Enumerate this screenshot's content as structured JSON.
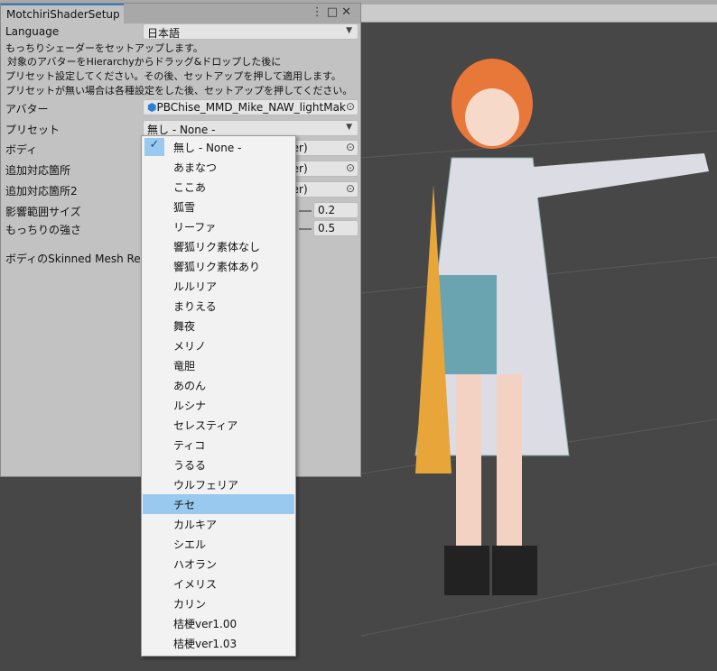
{
  "window": {
    "title": "MotchiriShaderSetup",
    "icons": [
      "more-icon",
      "maximize-icon",
      "close-icon"
    ]
  },
  "language": {
    "label": "Language",
    "value": "日本語"
  },
  "description": [
    "もっちりシェーダーをセットアップします。",
    "対象のアバターをHierarchyからドラッグ&ドロップした後に",
    "プリセット設定してください。その後、セットアップを押して適用します。",
    "プリセットが無い場合は各種設定をした後、セットアップを押してください。"
  ],
  "avatar": {
    "label": "アバター",
    "value": "PBChise_MMD_Mike_NAW_lightMake"
  },
  "preset": {
    "label": "プリセット",
    "value": "無し - None -"
  },
  "body": {
    "label": "ボディ",
    "value": "rer)"
  },
  "extra1": {
    "label": "追加対応箇所",
    "value": "rer)"
  },
  "extra2": {
    "label": "追加対応箇所2",
    "value": "rer)"
  },
  "range": {
    "label": "影響範囲サイズ",
    "value": "0.2"
  },
  "strength": {
    "label": "もっちりの強さ",
    "value": "0.5"
  },
  "skinned_label": "ボディのSkinned Mesh Rend",
  "dropdown": {
    "checked": 0,
    "highlighted": 18,
    "items": [
      "無し - None -",
      "あまなつ",
      "ここあ",
      "狐雪",
      "リーファ",
      "響狐リク素体なし",
      "響狐リク素体あり",
      "ルルリア",
      "まりえる",
      "舞夜",
      "メリノ",
      "竜胆",
      "あのん",
      "ルシナ",
      "セレスティア",
      "ティコ",
      "うるる",
      "ウルフェリア",
      "チセ",
      "カルキア",
      "シエル",
      "ハオラン",
      "イメリス",
      "カリン",
      "桔梗ver1.00",
      "桔梗ver1.03"
    ]
  }
}
